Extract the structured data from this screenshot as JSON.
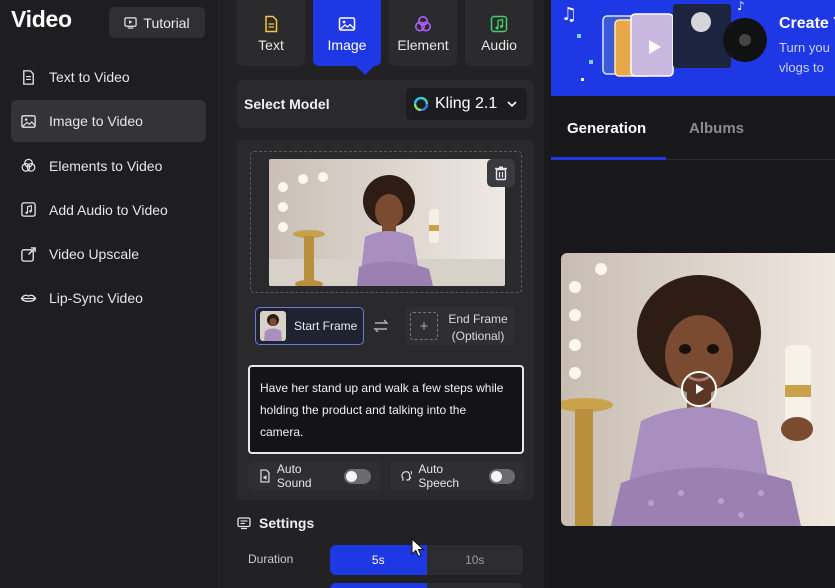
{
  "sidebar": {
    "brand": "Video",
    "tutorial_label": "Tutorial",
    "items": [
      {
        "label": "Text to Video",
        "icon": "document-icon"
      },
      {
        "label": "Image to Video",
        "icon": "image-icon",
        "active": true
      },
      {
        "label": "Elements to Video",
        "icon": "elements-icon"
      },
      {
        "label": "Add Audio to Video",
        "icon": "add-audio-icon"
      },
      {
        "label": "Video Upscale",
        "icon": "upscale-icon"
      },
      {
        "label": "Lip-Sync Video",
        "icon": "lips-icon"
      }
    ]
  },
  "mode_tabs": [
    {
      "label": "Text",
      "icon": "text-file-icon",
      "color": "#f5c542"
    },
    {
      "label": "Image",
      "icon": "image-icon",
      "active": true,
      "color": "#ffffff"
    },
    {
      "label": "Element",
      "icon": "element-icon",
      "color": "#b05cff"
    },
    {
      "label": "Audio",
      "icon": "music-icon",
      "color": "#3ecf6a"
    }
  ],
  "model": {
    "label": "Select Model",
    "selected": "Kling 2.1"
  },
  "frames": {
    "start_label": "Start Frame",
    "end_label_line1": "End Frame",
    "end_label_line2": "(Optional)",
    "end_plus": "+"
  },
  "prompt": {
    "text": "Have her stand up and walk a few steps while holding the product and talking into the camera."
  },
  "toggles": {
    "auto_sound": "Auto Sound",
    "auto_speech": "Auto Speech"
  },
  "settings": {
    "title": "Settings",
    "duration_label": "Duration",
    "duration_options": [
      "5s",
      "10s"
    ],
    "duration_selected": "5s"
  },
  "banner": {
    "title": "Create Y",
    "subtitle_line1": "Turn you",
    "subtitle_line2": "vlogs to"
  },
  "results": {
    "tabs": [
      "Generation",
      "Albums"
    ],
    "active_tab": "Generation"
  },
  "colors": {
    "accent": "#1e38e6",
    "panel": "#2a2a2d",
    "background": "#1b1b1d"
  }
}
